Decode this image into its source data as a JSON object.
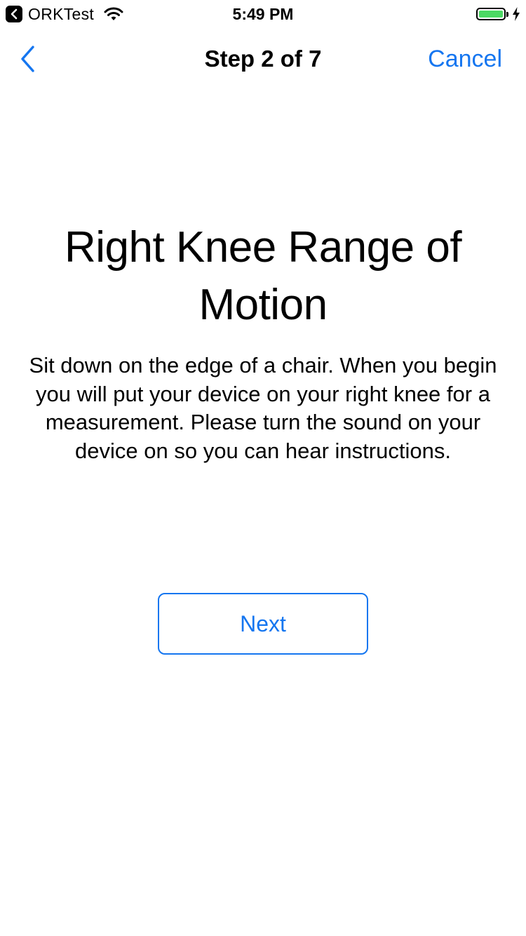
{
  "status_bar": {
    "back_app_label": "ORKTest",
    "time": "5:49 PM",
    "battery_level": 1.0,
    "battery_color": "#4cd964",
    "icons": [
      "back-chevron-icon",
      "wifi-icon",
      "battery-icon",
      "charging-bolt-icon"
    ]
  },
  "nav": {
    "back_icon": "chevron-left-icon",
    "title": "Step 2 of 7",
    "cancel_label": "Cancel"
  },
  "step": {
    "title": "Right Knee Range of Motion",
    "detail": "Sit down on the edge of a chair. When you begin you will put your device on your right knee for a measurement. Please turn the sound on your device on so you can hear instructions.",
    "next_label": "Next"
  },
  "colors": {
    "accent": "#1576f0",
    "background": "#ffffff",
    "text": "#000000"
  }
}
